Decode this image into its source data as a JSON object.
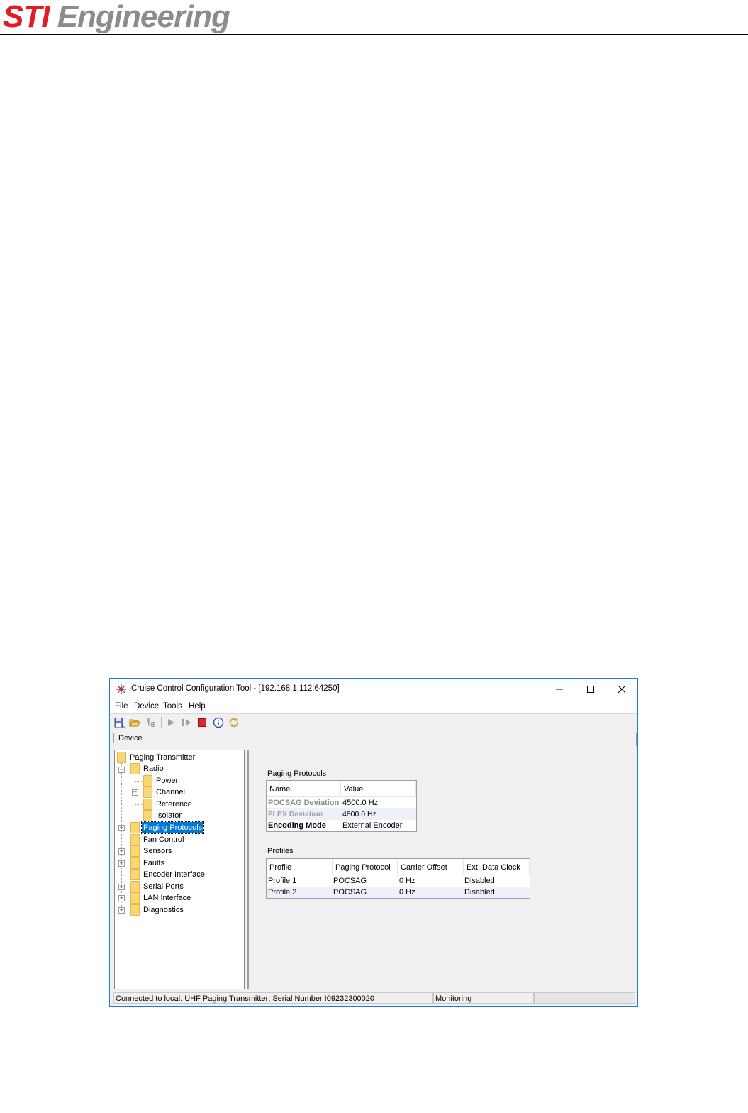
{
  "logo": {
    "part1": "STI",
    "part2": "Engineering"
  },
  "window": {
    "title": "Cruise Control Configuration Tool - [192.168.1.112:64250]",
    "menu": [
      "File",
      "Device",
      "Tools",
      "Help"
    ],
    "device_tab": "Device"
  },
  "tree": {
    "root": "Paging Transmitter",
    "radio": "Radio",
    "radio_children": [
      "Power",
      "Channel",
      "Reference",
      "Isolator"
    ],
    "items": [
      "Paging Protocols",
      "Fan Control",
      "Sensors",
      "Faults",
      "Encoder Interface",
      "Serial Ports",
      "LAN Interface",
      "Diagnostics"
    ],
    "selected": "Paging Protocols"
  },
  "paging_protocols": {
    "title": "Paging Protocols",
    "headers": [
      "Name",
      "Value"
    ],
    "rows": [
      {
        "name": "POCSAG Deviation",
        "value": "4500.0 Hz"
      },
      {
        "name": "FLEX Deviation",
        "value": "4800.0 Hz"
      },
      {
        "name": "Encoding Mode",
        "value": "External Encoder"
      }
    ]
  },
  "profiles": {
    "title": "Profiles",
    "headers": [
      "Profile",
      "Paging Protocol",
      "Carrier Offset",
      "Ext. Data Clock"
    ],
    "rows": [
      [
        "Profile 1",
        "POCSAG",
        "0 Hz",
        "Disabled"
      ],
      [
        "Profile 2",
        "POCSAG",
        "0 Hz",
        "Disabled"
      ]
    ]
  },
  "status": {
    "connection": "Connected to local: UHF Paging Transmitter; Serial Number I09232300020",
    "mode": "Monitoring",
    "extra": ""
  },
  "icons": [
    "app-icon",
    "save-icon",
    "open-folder-icon",
    "tree-icon",
    "play-icon",
    "step-icon",
    "stop-icon",
    "info-icon",
    "sync-icon",
    "minimize-icon",
    "maximize-icon",
    "close-icon"
  ]
}
